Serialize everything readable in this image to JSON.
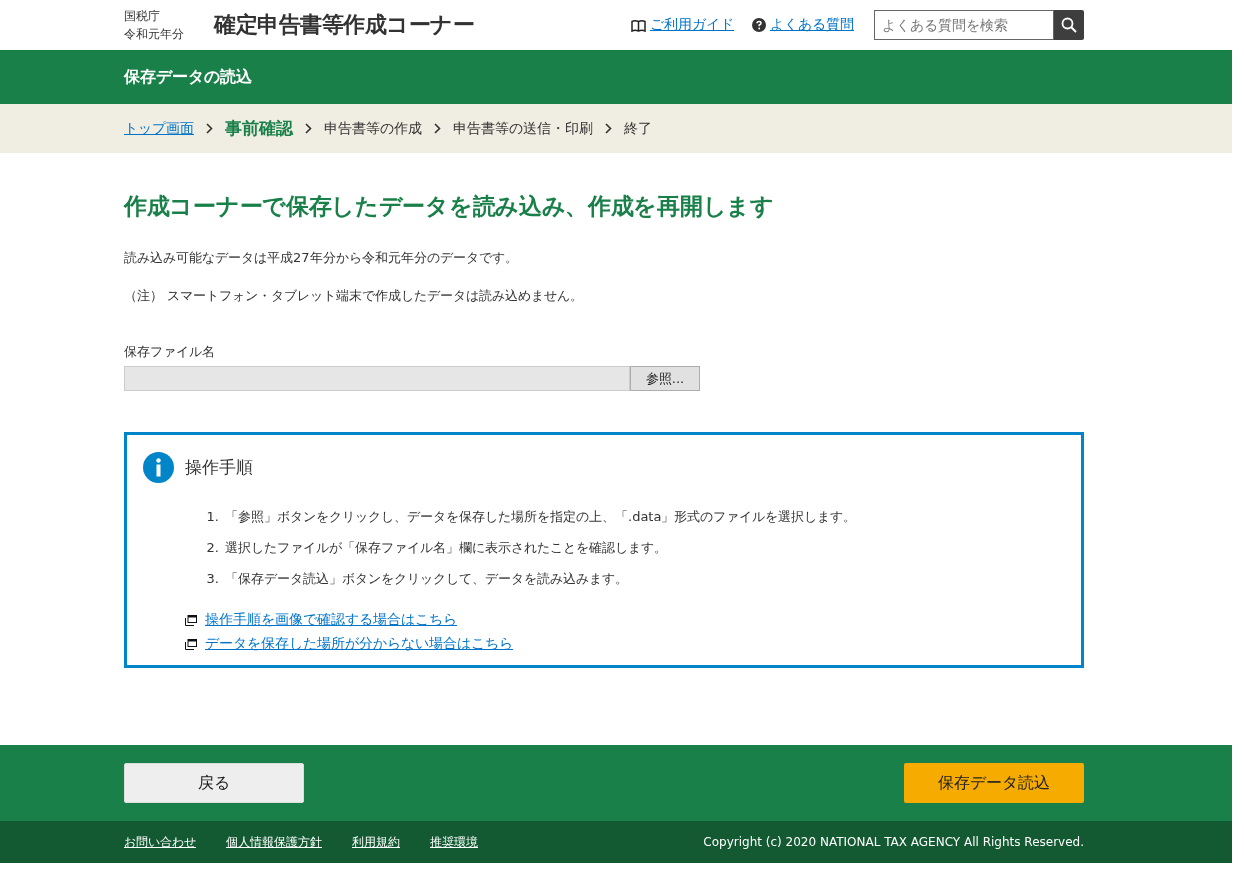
{
  "header": {
    "agency": "国税庁",
    "year": "令和元年分",
    "title": "確定申告書等作成コーナー",
    "links": [
      "ご利用ガイド",
      "よくある質問"
    ],
    "search": {
      "placeholder": "よくある質問を検索"
    }
  },
  "page_title_bar": "保存データの読込",
  "breadcrumb": [
    {
      "label": "トップ画面",
      "kind": "link"
    },
    {
      "label": "事前確認",
      "kind": "current"
    },
    {
      "label": "申告書等の作成",
      "kind": "step"
    },
    {
      "label": "申告書等の送信・印刷",
      "kind": "step"
    },
    {
      "label": "終了",
      "kind": "step"
    }
  ],
  "heading": "作成コーナーで保存したデータを読み込み、作成を再開します",
  "description": "読み込み可能なデータは平成27年分から令和元年分のデータです。",
  "note": "（注） スマートフォン・タブレット端末で作成したデータは読み込めません。",
  "file_field": {
    "label": "保存ファイル名",
    "browse_button": "参照..."
  },
  "info_box": {
    "title": "操作手順",
    "steps": [
      {
        "number": "1.",
        "text": "「参照」ボタンをクリックし、データを保存した場所を指定の上、「.data」形式のファイルを選択します。"
      },
      {
        "number": "2.",
        "text": "選択したファイルが「保存ファイル名」欄に表示されたことを確認します。"
      },
      {
        "number": "3.",
        "text": "「保存データ読込」ボタンをクリックして、データを読み込みます。"
      }
    ],
    "links": [
      "操作手順を画像で確認する場合はこちら",
      "データを保存した場所が分からない場合はこちら"
    ]
  },
  "actions": {
    "back": "戻る",
    "load": "保存データ読込"
  },
  "footer": {
    "links": [
      "お問い合わせ",
      "個人情報保護方針",
      "利用規約",
      "推奨環境"
    ],
    "copyright": "Copyright (c) 2020 NATIONAL TAX AGENCY All Rights Reserved."
  }
}
